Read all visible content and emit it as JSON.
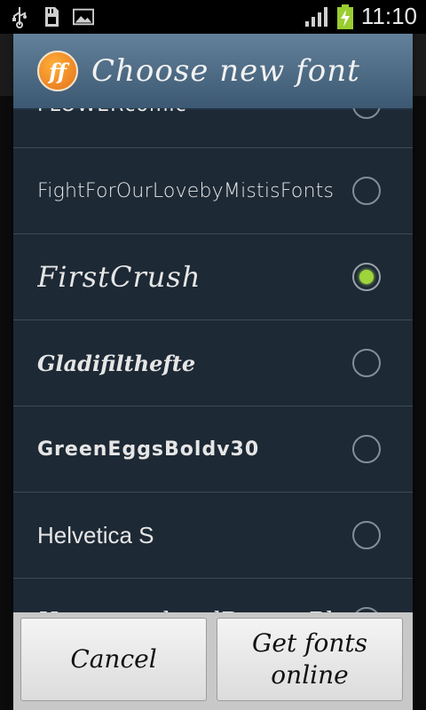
{
  "status_bar": {
    "time": "11:10",
    "icons": [
      "usb-icon",
      "sd-card-icon",
      "image-icon",
      "signal-icon",
      "battery-charging-icon"
    ]
  },
  "dialog": {
    "title": "Choose new font",
    "logo_text": "ff",
    "fonts": [
      {
        "label": "FLOWERcomic",
        "selected": false
      },
      {
        "label": "FightForOurLovebyMistisFonts",
        "selected": false
      },
      {
        "label": "FirstCrush",
        "selected": true
      },
      {
        "label": "Gladifilthefte",
        "selected": false
      },
      {
        "label": "GreenEggsBoldv30",
        "selected": false
      },
      {
        "label": "Helvetica S",
        "selected": false
      },
      {
        "label": "HoneycombandBananaBlu",
        "selected": false
      }
    ],
    "buttons": {
      "cancel": "Cancel",
      "get_fonts": "Get fonts online"
    }
  },
  "colors": {
    "dialog_bg": "#1d2935",
    "header": "#4f6d87",
    "radio_selected": "#9ed53a"
  }
}
